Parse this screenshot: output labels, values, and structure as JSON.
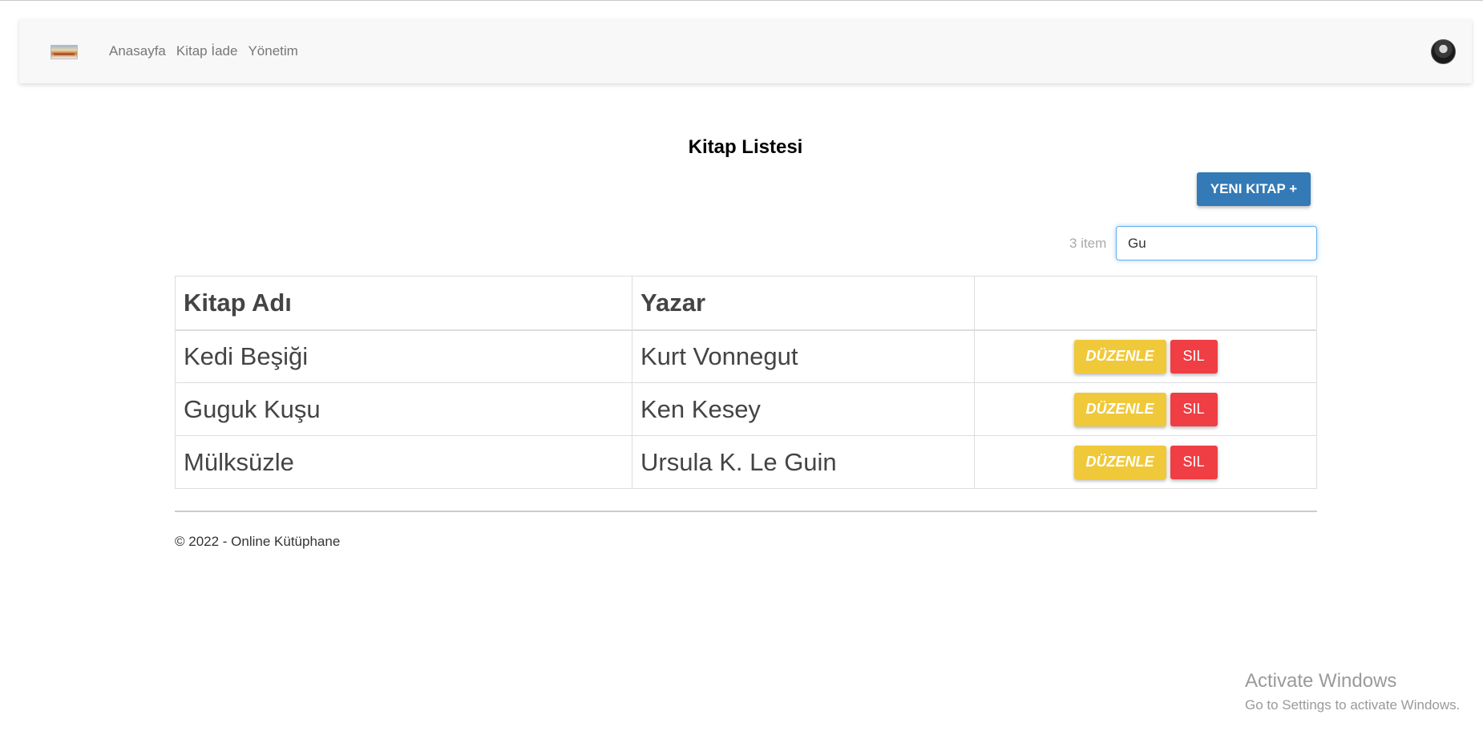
{
  "navbar": {
    "links": [
      "Anasayfa",
      "Kitap İade",
      "Yönetim"
    ]
  },
  "page": {
    "title": "Kitap Listesi",
    "new_button": "YENI KITAP +",
    "item_count": "3 item",
    "search_value": "Gu"
  },
  "table": {
    "headers": [
      "Kitap Adı",
      "Yazar",
      ""
    ],
    "rows": [
      {
        "title": "Kedi Beşiği",
        "author": "Kurt Vonnegut"
      },
      {
        "title": "Guguk Kuşu",
        "author": "Ken Kesey"
      },
      {
        "title": "Mülksüzle",
        "author": "Ursula K. Le Guin"
      }
    ],
    "edit_label": "DÜZENLE",
    "delete_label": "SIL"
  },
  "footer": {
    "text": "© 2022 - Online Kütüphane"
  },
  "watermark": {
    "line1": "Activate Windows",
    "line2": "Go to Settings to activate Windows."
  },
  "colors": {
    "primary": "#337ab7",
    "edit": "#f0c93a",
    "delete": "#ef3e44"
  }
}
